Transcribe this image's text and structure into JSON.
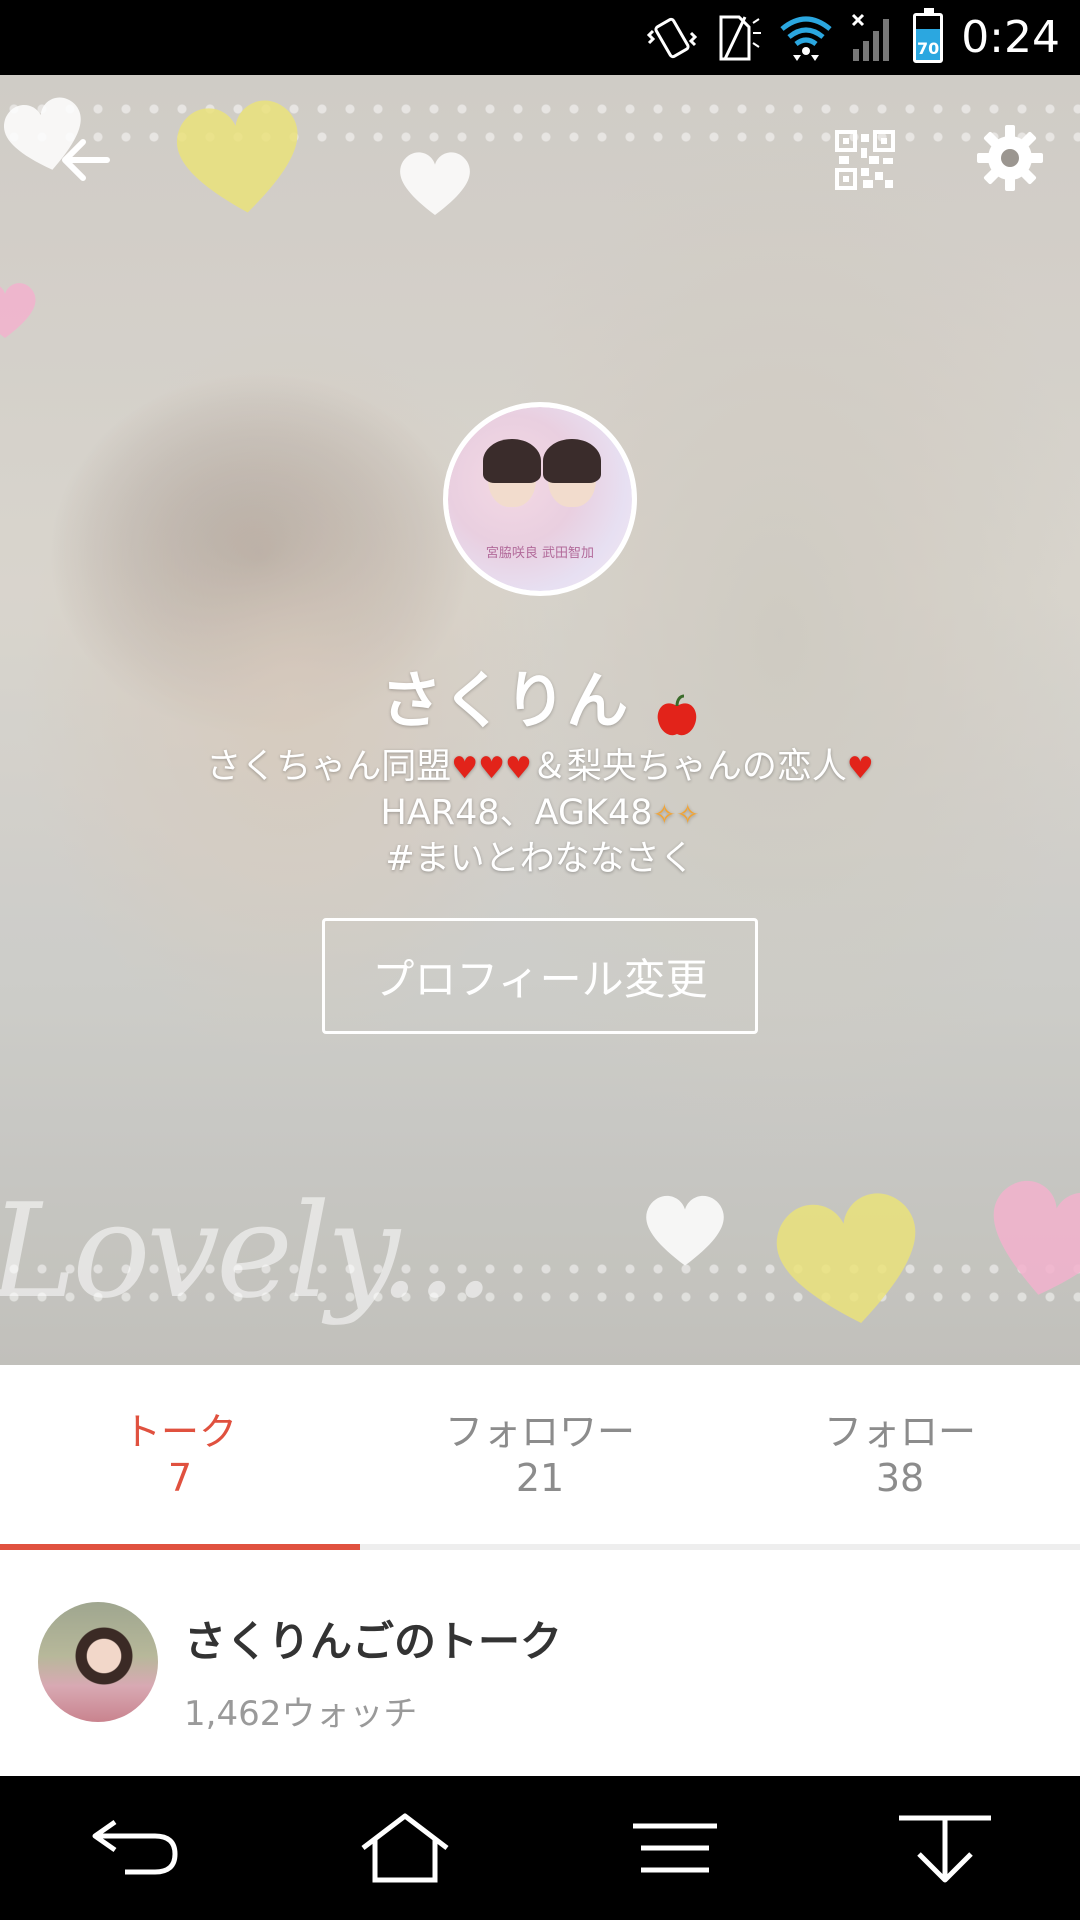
{
  "status_bar": {
    "time": "0:24",
    "battery_level": "70",
    "icons": [
      "vibrate-icon",
      "no-sim-icon",
      "wifi-icon",
      "signal-icon",
      "battery-icon"
    ]
  },
  "header": {
    "back_icon": "arrow-back-icon",
    "qr_icon": "qr-code-icon",
    "settings_icon": "gear-icon"
  },
  "profile": {
    "avatar_caption": "宮脇咲良 武田智加",
    "name": "さくりん",
    "bio_line1_a": "さくちゃん同盟",
    "bio_line1_b": "＆梨央ちゃんの恋人",
    "bio_line2": "HAR48、AGK48",
    "bio_line3": "#まいとわななさく",
    "edit_button": "プロフィール変更"
  },
  "cover": {
    "lovely_text": "Lovely..."
  },
  "tabs": [
    {
      "label": "トーク",
      "count": "7",
      "active": true
    },
    {
      "label": "フォロワー",
      "count": "21",
      "active": false
    },
    {
      "label": "フォロー",
      "count": "38",
      "active": false
    }
  ],
  "talks": [
    {
      "title": "さくりんごのトーク",
      "watch": "1,462ウォッチ"
    }
  ],
  "colors": {
    "accent": "#e0513f",
    "heart_red": "#e2231a",
    "battery_blue": "#2ba7e0"
  }
}
